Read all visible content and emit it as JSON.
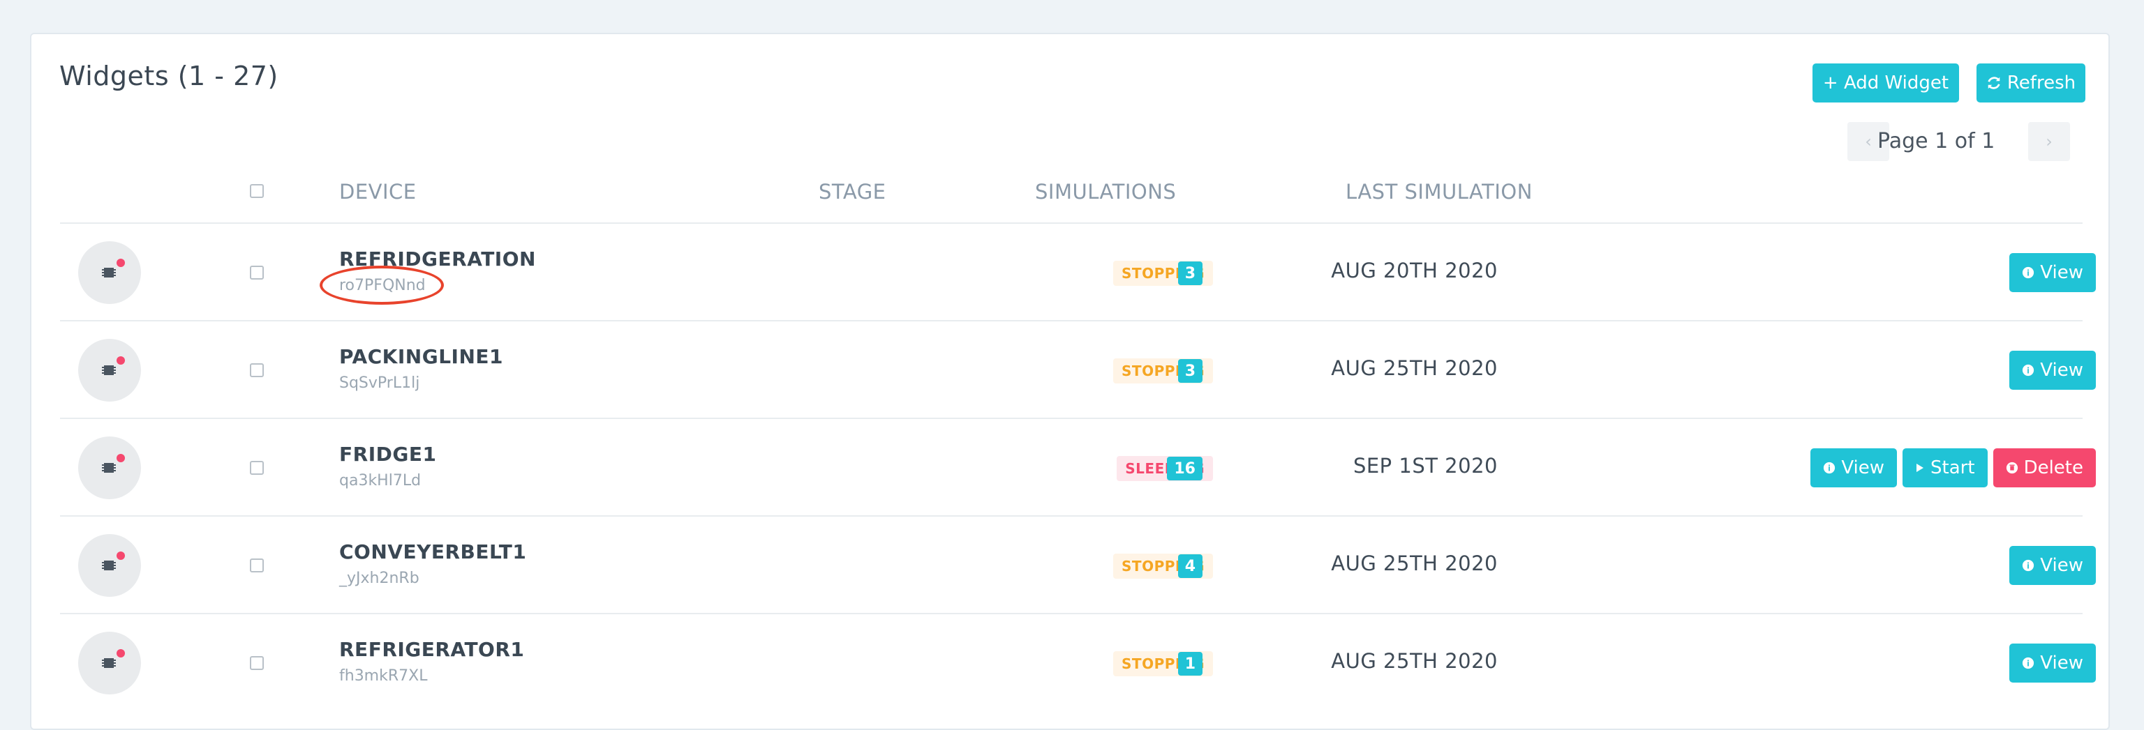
{
  "header": {
    "title": "Widgets (1 - 27)",
    "add_label": "+ Add Widget",
    "refresh_label": "Refresh"
  },
  "pager": {
    "text": "Page 1 of 1",
    "prev_symbol": "‹",
    "next_symbol": "›"
  },
  "table": {
    "columns": [
      "DEVICE",
      "STAGE",
      "SIMULATIONS",
      "LAST SIMULATION"
    ],
    "rows": [
      {
        "name": "REFRIDGERATION",
        "id": "ro7PFQNnd",
        "stage": "STOPPING",
        "simulations": "3",
        "last": "AUG 20TH 2020",
        "actions": [
          "View"
        ]
      },
      {
        "name": "PACKINGLINE1",
        "id": "SqSvPrL1lj",
        "stage": "STOPPING",
        "simulations": "3",
        "last": "AUG 25TH 2020",
        "actions": [
          "View"
        ]
      },
      {
        "name": "FRIDGE1",
        "id": "qa3kHl7Ld",
        "stage": "SLEEPING",
        "simulations": "16",
        "last": "SEP 1ST 2020",
        "actions": [
          "View",
          "Start",
          "Delete"
        ]
      },
      {
        "name": "CONVEYERBELT1",
        "id": "_yJxh2nRb",
        "stage": "STOPPING",
        "simulations": "4",
        "last": "AUG 25TH 2020",
        "actions": [
          "View"
        ]
      },
      {
        "name": "REFRIGERATOR1",
        "id": "fh3mkR7XL",
        "stage": "STOPPING",
        "simulations": "1",
        "last": "AUG 25TH 2020",
        "actions": [
          "View"
        ]
      }
    ]
  },
  "colors": {
    "accent": "#20c3d6",
    "danger": "#f5486e",
    "warning": "#f5a623",
    "annotation": "#e8432c"
  }
}
